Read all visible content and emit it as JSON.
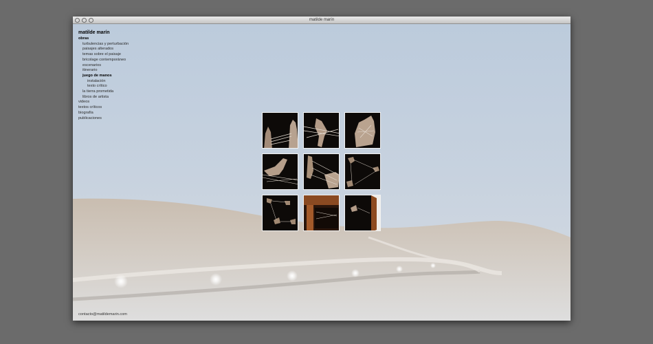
{
  "window": {
    "title": "matilde marín"
  },
  "nav": {
    "site_title": "matilde marín",
    "items": [
      {
        "label": "obras",
        "level": 0,
        "bold": true
      },
      {
        "label": "turbulencias y perturbación",
        "level": 1,
        "bold": false
      },
      {
        "label": "paisajes alterados",
        "level": 1,
        "bold": false
      },
      {
        "label": "temas sobre el paisaje",
        "level": 1,
        "bold": false
      },
      {
        "label": "bricolage contemporáneo",
        "level": 1,
        "bold": false
      },
      {
        "label": "escenarios",
        "level": 1,
        "bold": false
      },
      {
        "label": "itinerario",
        "level": 1,
        "bold": false
      },
      {
        "label": "juego de manos",
        "level": 1,
        "bold": true
      },
      {
        "label": "instalación",
        "level": 2,
        "bold": false
      },
      {
        "label": "texto crítico",
        "level": 2,
        "bold": false
      },
      {
        "label": "la tierra prometida",
        "level": 1,
        "bold": false
      },
      {
        "label": "libros de artista",
        "level": 1,
        "bold": false
      },
      {
        "label": "videos",
        "level": 0,
        "bold": false
      },
      {
        "label": "textos críticos",
        "level": 0,
        "bold": false
      },
      {
        "label": "biografía",
        "level": 0,
        "bold": false
      },
      {
        "label": "publicaciones",
        "level": 0,
        "bold": false
      }
    ]
  },
  "gallery": {
    "rows": 3,
    "cols": 3,
    "thumbnail_count": 9
  },
  "footer": {
    "contact": "contacto@matildemarin.com"
  }
}
